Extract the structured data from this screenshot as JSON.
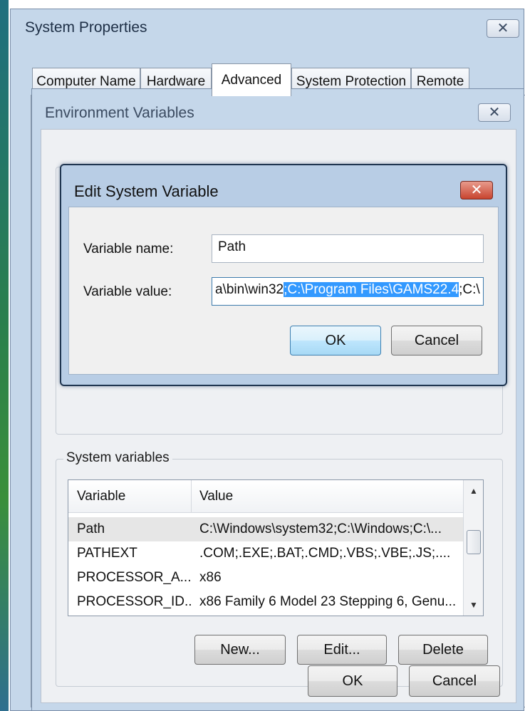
{
  "system_properties": {
    "title": "System Properties",
    "close_glyph": "✕",
    "tabs": [
      {
        "label": "Computer Name",
        "active": false
      },
      {
        "label": "Hardware",
        "active": false
      },
      {
        "label": "Advanced",
        "active": true
      },
      {
        "label": "System Protection",
        "active": false
      },
      {
        "label": "Remote",
        "active": false
      }
    ]
  },
  "environment_variables": {
    "title": "Environment Variables",
    "close_glyph": "✕",
    "system_variables": {
      "group_label": "System variables",
      "columns": [
        "Variable",
        "Value"
      ],
      "rows": [
        {
          "variable": "Path",
          "value": "C:\\Windows\\system32;C:\\Windows;C:\\...",
          "selected": true
        },
        {
          "variable": "PATHEXT",
          "value": ".COM;.EXE;.BAT;.CMD;.VBS;.VBE;.JS;....",
          "selected": false
        },
        {
          "variable": "PROCESSOR_A...",
          "value": "x86",
          "selected": false
        },
        {
          "variable": "PROCESSOR_ID...",
          "value": "x86 Family 6 Model 23 Stepping 6, Genu...",
          "selected": false
        }
      ],
      "buttons": {
        "new": "New...",
        "edit": "Edit...",
        "delete": "Delete"
      }
    },
    "buttons": {
      "ok": "OK",
      "cancel": "Cancel"
    }
  },
  "edit_system_variable": {
    "title": "Edit System Variable",
    "close_glyph": "✕",
    "name_label": "Variable name:",
    "name_value": "Path",
    "value_label": "Variable value:",
    "value_text_before": "a\\bin\\win32",
    "value_text_selected": ";C:\\Program Files\\GAMS22.4",
    "value_text_after": ";C:\\",
    "buttons": {
      "ok": "OK",
      "cancel": "Cancel"
    }
  },
  "colors": {
    "window_frame": "#c5d7ea",
    "selection": "#3399ff",
    "edit_close_red": "#c8442f"
  }
}
